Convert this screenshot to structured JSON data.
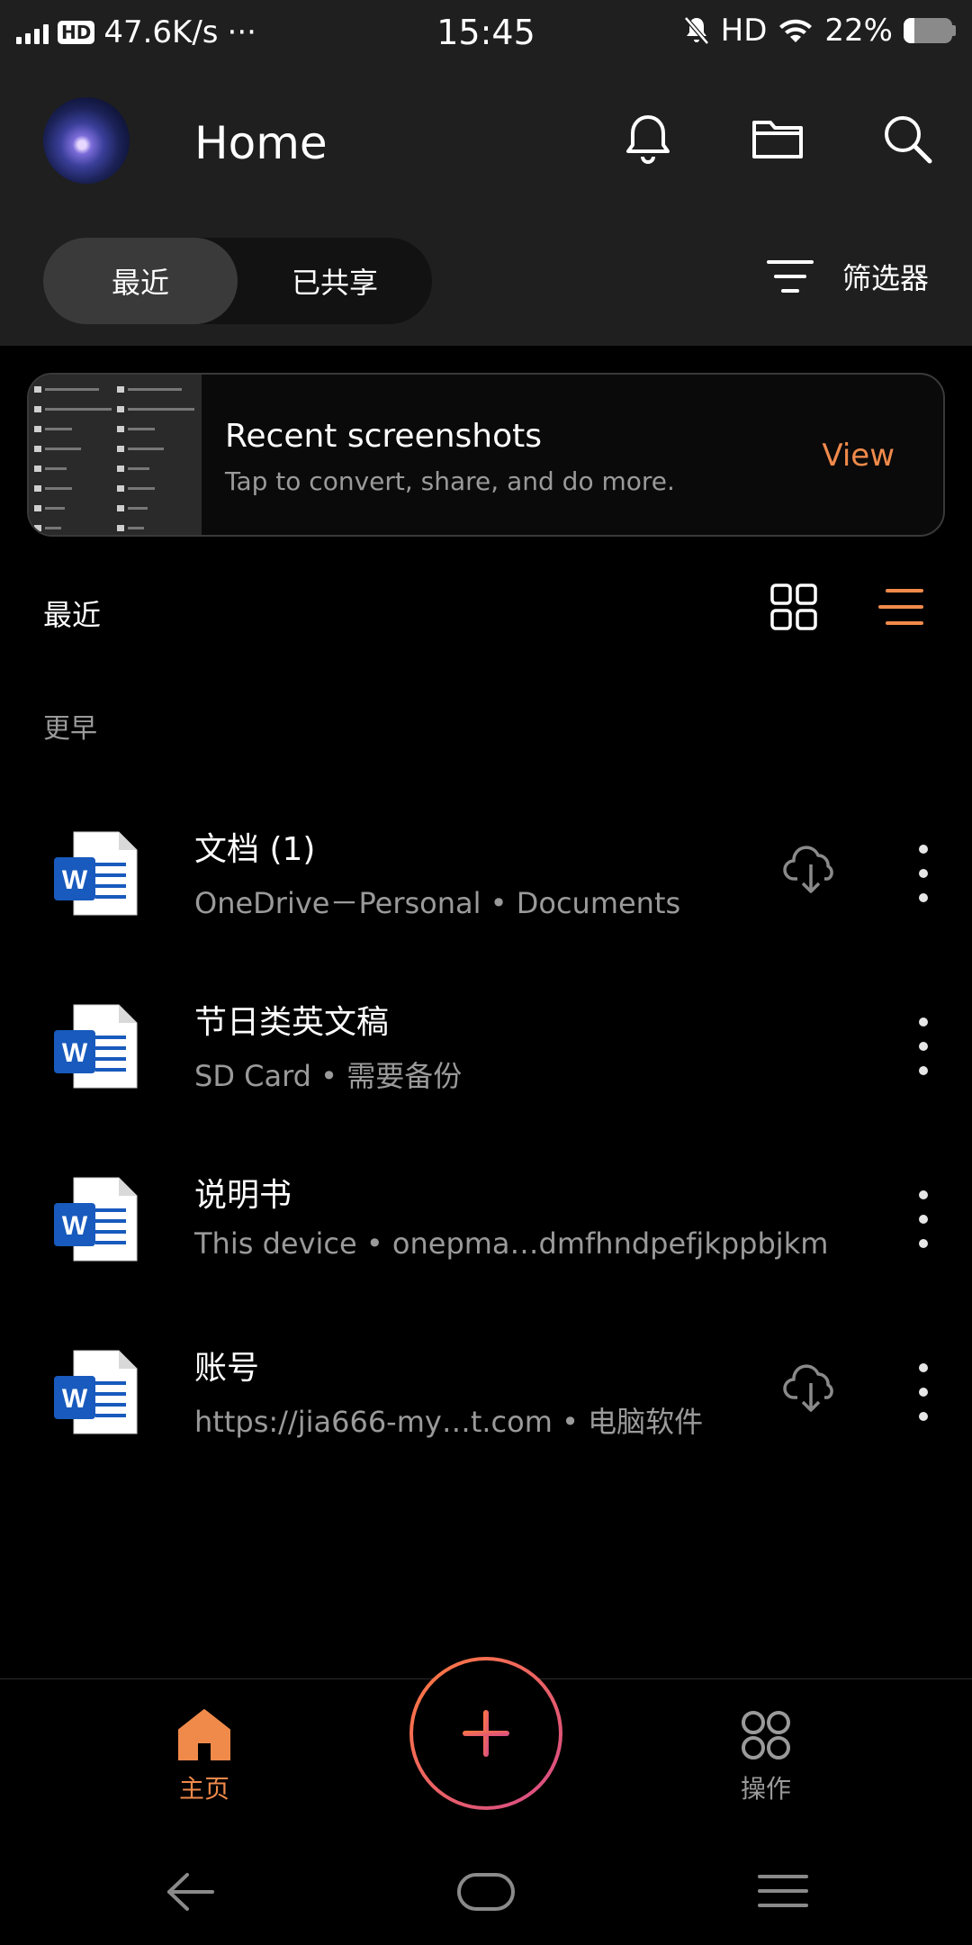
{
  "status": {
    "net_speed": "47.6K/s",
    "more": "···",
    "time": "15:45",
    "hd": "HD",
    "battery": "22%",
    "battery_level": 0.22
  },
  "header": {
    "title": "Home"
  },
  "tabs": {
    "recent": "最近",
    "shared": "已共享",
    "filter": "筛选器"
  },
  "banner": {
    "title": "Recent screenshots",
    "subtitle": "Tap to convert, share, and do more.",
    "action": "View"
  },
  "list": {
    "section": "最近",
    "group": "更早",
    "files": [
      {
        "name": "文档 (1)",
        "meta": "OneDrive－Personal • Documents",
        "cloud": true
      },
      {
        "name": "节日类英文稿",
        "meta": "SD Card • 需要备份",
        "cloud": false
      },
      {
        "name": "说明书",
        "meta": "This device • onepma…dmfhndpefjkppbjkm",
        "cloud": false
      },
      {
        "name": "账号",
        "meta": "https://jia666-my…t.com • 电脑软件",
        "cloud": true
      }
    ]
  },
  "bottom_nav": {
    "home": "主页",
    "actions": "操作"
  },
  "colors": {
    "accent": "#f08a4b",
    "header_bg": "#1f1f1f",
    "background": "#000000",
    "word_blue": "#185abd"
  }
}
